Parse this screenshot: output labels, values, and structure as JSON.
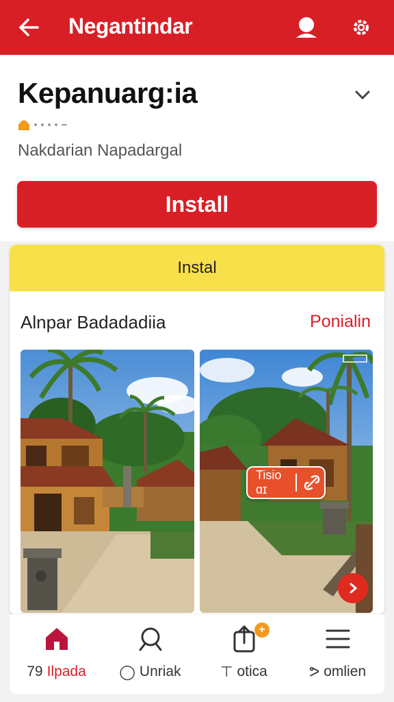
{
  "topbar": {
    "title": "Negantindar",
    "color": "#d91f26"
  },
  "app": {
    "name": "Kepanuarg:ia",
    "developer": "Nakdarian Napadargal"
  },
  "install_button": {
    "label": "Install"
  },
  "panel": {
    "header_label": "Instal",
    "section_title": "Alnpar Badadadiia",
    "section_link": "Ponialin",
    "overlay_chip_text": "Tisio ɑɪ"
  },
  "bottom_nav": {
    "items": [
      {
        "icon": "home-icon",
        "prefix": "79",
        "label": "Ilpada",
        "active": true
      },
      {
        "icon": "search-icon",
        "prefix": "◯",
        "label": "Unriak",
        "active": false
      },
      {
        "icon": "share-icon",
        "prefix": "⊤",
        "label": "otica",
        "badge": "+",
        "active": false
      },
      {
        "icon": "menu-icon",
        "prefix": "ᕗ",
        "label": "omlien",
        "active": false
      }
    ]
  },
  "colors": {
    "accent": "#d91f26",
    "panel_header": "#f8e04a",
    "chip": "#e8502c",
    "badge": "#f39a1e"
  }
}
